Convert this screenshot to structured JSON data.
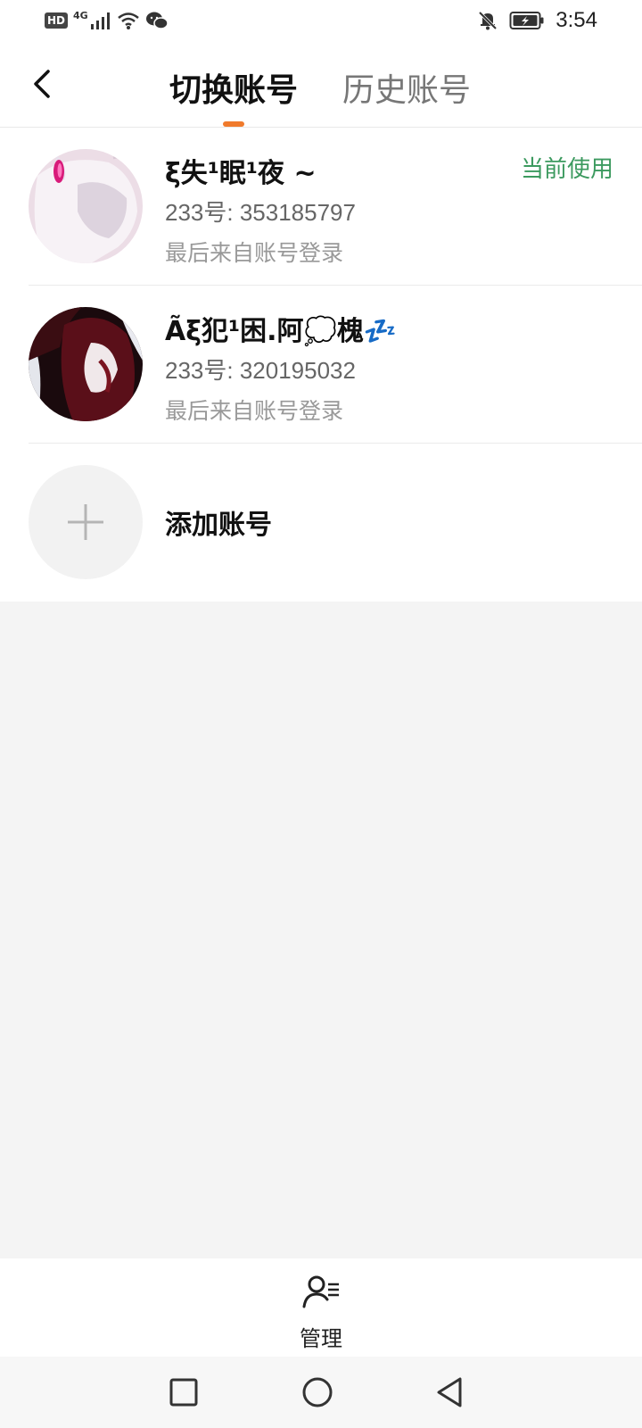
{
  "status_bar": {
    "hd_badge": "HD",
    "network": "4G",
    "time": "3:54",
    "icons": [
      "signal-icon",
      "wifi-icon",
      "wechat-icon",
      "notifications-off-icon",
      "battery-charging-icon"
    ]
  },
  "header": {
    "tabs": [
      {
        "label": "切换账号",
        "active": true
      },
      {
        "label": "历史账号",
        "active": false
      }
    ],
    "accent_color": "#f07a2c"
  },
  "accounts": [
    {
      "name": "ξ失¹眠¹夜 ~",
      "id": "233号: 353185797",
      "note": "最后来自账号登录",
      "badge": "当前使用"
    },
    {
      "name": "Ãξ犯¹困.阿💭槐💤",
      "id": "233号: 320195032",
      "note": "最后来自账号登录"
    }
  ],
  "add_account": {
    "label": "添加账号"
  },
  "bottom": {
    "manage_label": "管理"
  },
  "colors": {
    "current_badge": "#3c9a5f"
  }
}
